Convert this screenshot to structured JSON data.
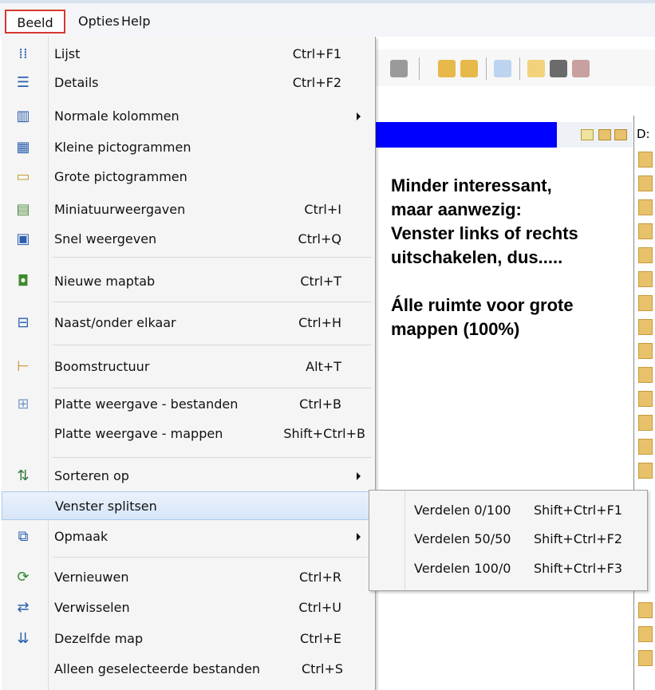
{
  "menubar": {
    "items": [
      {
        "label": "Beeld",
        "mnemonic": "l"
      },
      {
        "label": "Opties",
        "mnemonic": "O"
      },
      {
        "label": "Help",
        "mnemonic": "H"
      }
    ]
  },
  "note": {
    "line1": "Minder interessant,",
    "line2": "maar aanwezig:",
    "line3": "Venster links of rechts",
    "line4": "uitschakelen, dus.....",
    "line5": "Álle ruimte voor grote",
    "line6": "mappen (100%)"
  },
  "right_pane": {
    "header": "D:"
  },
  "menu": {
    "items": [
      {
        "icon": "list-view-icon",
        "label": "Lijst",
        "shortcut": "Ctrl+F1"
      },
      {
        "icon": "details-view-icon",
        "label": "Details",
        "shortcut": "Ctrl+F2"
      },
      {
        "icon": "columns-icon",
        "label": "Normale kolommen",
        "shortcut": "",
        "submenu": true
      },
      {
        "icon": "small-icons-icon",
        "label": "Kleine pictogrammen",
        "shortcut": ""
      },
      {
        "icon": "large-icons-icon",
        "label": "Grote pictogrammen",
        "shortcut": ""
      },
      {
        "icon": "thumbnails-icon",
        "label": "Miniatuurweergaven",
        "shortcut": "Ctrl+I"
      },
      {
        "icon": "quick-view-icon",
        "label": "Snel weergeven",
        "shortcut": "Ctrl+Q"
      },
      {
        "icon": "new-folder-tab-icon",
        "label": "Nieuwe maptab",
        "shortcut": "Ctrl+T"
      },
      {
        "icon": "split-horizontal-icon",
        "label": "Naast/onder elkaar",
        "shortcut": "Ctrl+H"
      },
      {
        "icon": "tree-icon",
        "label": "Boomstructuur",
        "shortcut": "Alt+T"
      },
      {
        "icon": "flat-view-icon",
        "label": "Platte weergave - bestanden",
        "shortcut": "Ctrl+B"
      },
      {
        "icon": "",
        "label": "Platte weergave - mappen",
        "shortcut": "Shift+Ctrl+B"
      },
      {
        "icon": "sort-icon",
        "label": "Sorteren op",
        "shortcut": "",
        "submenu": true
      },
      {
        "icon": "",
        "label": "Venster splitsen",
        "shortcut": "",
        "submenu": true,
        "highlighted": true
      },
      {
        "icon": "layout-icon",
        "label": "Opmaak",
        "shortcut": "",
        "submenu": true
      },
      {
        "icon": "refresh-icon",
        "label": "Vernieuwen",
        "shortcut": "Ctrl+R"
      },
      {
        "icon": "swap-icon",
        "label": "Verwisselen",
        "shortcut": "Ctrl+U"
      },
      {
        "icon": "same-folder-icon",
        "label": "Dezelfde map",
        "shortcut": "Ctrl+E"
      },
      {
        "icon": "",
        "label": "Alleen geselecteerde bestanden",
        "shortcut": "Ctrl+S"
      }
    ]
  },
  "submenu": {
    "items": [
      {
        "label": "Verdelen 0/100",
        "shortcut": "Shift+Ctrl+F1"
      },
      {
        "label": "Verdelen 50/50",
        "shortcut": "Shift+Ctrl+F2"
      },
      {
        "label": "Verdelen 100/0",
        "shortcut": "Shift+Ctrl+F3"
      }
    ]
  },
  "colors": {
    "accent_blue": "#0000ff",
    "highlight": "#d7e6f8",
    "beeld_border": "#d6372f"
  }
}
